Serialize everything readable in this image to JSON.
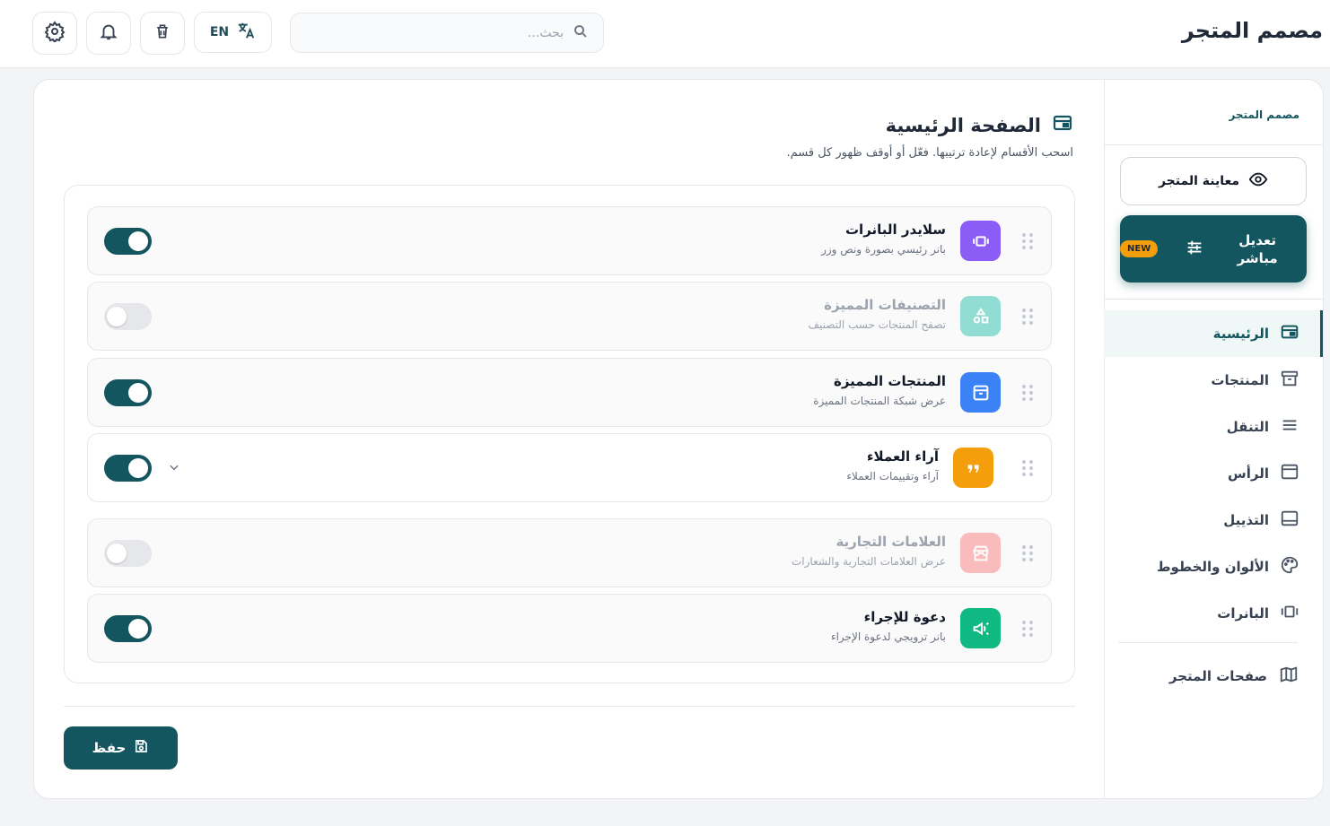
{
  "header": {
    "title": "مصمم المتجر",
    "search_placeholder": "بحث...",
    "language_label": "EN"
  },
  "sidebar": {
    "title": "مصمم المتجر",
    "preview_label": "معاينة المتجر",
    "live_edit_label": "تعديل مباشر",
    "new_badge": "NEW",
    "nav": [
      {
        "label": "الرئيسية",
        "icon": "layout-icon",
        "active": true
      },
      {
        "label": "المنتجات",
        "icon": "archive-icon"
      },
      {
        "label": "التنقل",
        "icon": "menu-icon"
      },
      {
        "label": "الرأس",
        "icon": "header-icon"
      },
      {
        "label": "التذييل",
        "icon": "footer-icon"
      },
      {
        "label": "الألوان والخطوط",
        "icon": "palette-icon"
      },
      {
        "label": "البانرات",
        "icon": "banners-icon"
      }
    ],
    "store_pages_label": "صفحات المتجر"
  },
  "page": {
    "title": "الصفحة الرئيسية",
    "subtitle": "اسحب الأقسام لإعادة ترتيبها. فعّل أو أوقف ظهور كل قسم."
  },
  "sections": [
    {
      "title": "سلايدر البانرات",
      "desc": "بانر رئيسي بصورة ونص وزر",
      "enabled": true,
      "icon": "slider-icon",
      "color": "#8b5cf6"
    },
    {
      "title": "التصنيفات المميزة",
      "desc": "تصفح المنتجات حسب التصنيف",
      "enabled": false,
      "icon": "shapes-icon",
      "color": "#14b8a6"
    },
    {
      "title": "المنتجات المميزة",
      "desc": "عرض شبكة المنتجات المميزة",
      "enabled": true,
      "icon": "box-icon",
      "color": "#3b82f6"
    },
    {
      "title": "آراء العملاء",
      "desc": "آراء وتقييمات العملاء",
      "enabled": true,
      "icon": "quote-icon",
      "color": "#f59e0b",
      "expandable": true
    },
    {
      "title": "العلامات التجارية",
      "desc": "عرض العلامات التجارية والشعارات",
      "enabled": false,
      "icon": "store-icon",
      "color": "#f87171"
    },
    {
      "title": "دعوة للإجراء",
      "desc": "بانر ترويجي لدعوة الإجراء",
      "enabled": true,
      "icon": "megaphone-icon",
      "color": "#10b981"
    }
  ],
  "save_label": "حفظ",
  "colors": {
    "primary": "#14565f",
    "accent": "#f59e0b"
  }
}
